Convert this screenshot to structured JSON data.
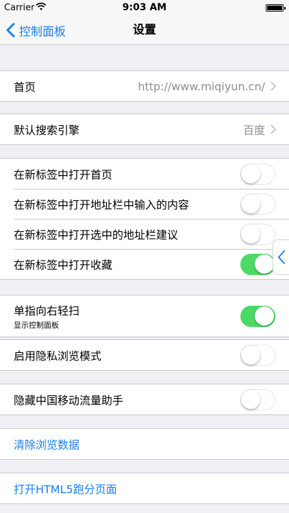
{
  "status_bar": {
    "carrier": "Carrier",
    "time": "9:03 AM",
    "wifi_icon": "wifi-icon",
    "battery_icon": "battery-icon"
  },
  "nav": {
    "back_label": "控制面板",
    "title": "设置"
  },
  "homepage": {
    "label": "首页",
    "value": "http://www.miqiyun.cn/"
  },
  "search_engine": {
    "label": "默认搜索引擎",
    "value": "百度"
  },
  "tabs_group": {
    "open_home_new_tab": {
      "label": "在新标签中打开首页",
      "on": false
    },
    "open_address_input_new_tab": {
      "label": "在新标签中打开地址栏中输入的内容",
      "on": false
    },
    "open_suggestion_new_tab": {
      "label": "在新标签中打开选中的地址栏建议",
      "on": false
    },
    "open_bookmark_new_tab": {
      "label": "在新标签中打开收藏",
      "on": true
    }
  },
  "swipe": {
    "label": "单指向右轻扫",
    "sublabel": "显示控制面板",
    "on": true
  },
  "private": {
    "label": "启用隐私浏览模式",
    "on": false
  },
  "hide_cmcc": {
    "label": "隐藏中国移动流量助手",
    "on": false
  },
  "clear_data": {
    "label": "清除浏览数据"
  },
  "html5_test": {
    "label": "打开HTML5跑分页面"
  },
  "colors": {
    "accent": "#1a7ef2",
    "switch_on": "#4cd964",
    "background": "#efeff4"
  }
}
